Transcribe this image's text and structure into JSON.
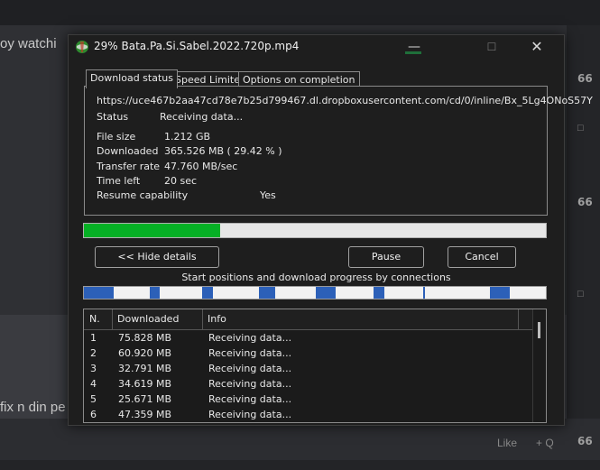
{
  "background": {
    "top_text": "oy watchi",
    "bottom_text": "fix n din pe",
    "reaction_label": "66",
    "like_label": "Like",
    "quote_label": "+ Q"
  },
  "window": {
    "title": "29% Bata.Pa.Si.Sabel.2022.720p.mp4",
    "minimize_glyph": "—",
    "maximize_glyph": "☐",
    "close_glyph": "✕",
    "app_icon": "idm-globe-icon"
  },
  "tabs": [
    {
      "label": "Download status",
      "active": true
    },
    {
      "label": "Speed Limiter",
      "active": false
    },
    {
      "label": "Options on completion",
      "active": false
    }
  ],
  "status": {
    "url": "https://uce467b2aa47cd78e7b25d799467.dl.dropboxusercontent.com/cd/0/inline/Bx_5Lg4ONoS57Y",
    "status_label": "Status",
    "status_value": "Receiving data...",
    "file_size_label": "File size",
    "file_size_value": "1.212  GB",
    "downloaded_label": "Downloaded",
    "downloaded_value": "365.526  MB  ( 29.42 % )",
    "transfer_rate_label": "Transfer rate",
    "transfer_rate_value": "47.760  MB/sec",
    "time_left_label": "Time left",
    "time_left_value": "20 sec",
    "resume_label": "Resume capability",
    "resume_value": "Yes"
  },
  "progress": {
    "fraction": 0.2942,
    "color": "#06b025"
  },
  "buttons": {
    "hide_details": "<< Hide details",
    "pause": "Pause",
    "cancel": "Cancel"
  },
  "connections_caption": "Start positions and download progress by connections",
  "connection_segments": [
    {
      "start": 0.0,
      "progress": 0.065
    },
    {
      "start": 0.143,
      "progress": 0.022
    },
    {
      "start": 0.255,
      "progress": 0.024
    },
    {
      "start": 0.378,
      "progress": 0.036
    },
    {
      "start": 0.502,
      "progress": 0.043
    },
    {
      "start": 0.627,
      "progress": 0.024
    },
    {
      "start": 0.734,
      "progress": 0.0
    },
    {
      "start": 0.878,
      "progress": 0.042
    }
  ],
  "table": {
    "headers": [
      "N.",
      "Downloaded",
      "Info"
    ],
    "rows": [
      [
        "1",
        "75.828  MB",
        "Receiving data..."
      ],
      [
        "2",
        "60.920  MB",
        "Receiving data..."
      ],
      [
        "3",
        "32.791  MB",
        "Receiving data..."
      ],
      [
        "4",
        "34.619  MB",
        "Receiving data..."
      ],
      [
        "5",
        "25.671  MB",
        "Receiving data..."
      ],
      [
        "6",
        "47.359  MB",
        "Receiving data..."
      ]
    ]
  }
}
